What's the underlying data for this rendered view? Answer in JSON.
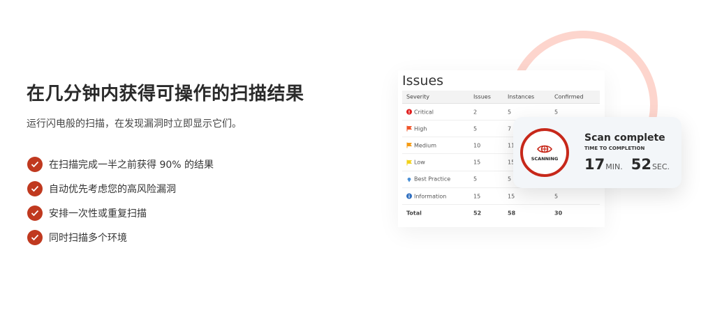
{
  "heading": "在几分钟内获得可操作的扫描结果",
  "subtitle": "运行闪电般的扫描，在发现漏洞时立即显示它们。",
  "features": [
    "在扫描完成一半之前获得 90% 的结果",
    "自动优先考虑您的高风险漏洞",
    "安排一次性或重复扫描",
    "同时扫描多个环境"
  ],
  "issues": {
    "title": "Issues",
    "headers": [
      "Severity",
      "Issues",
      "Instances",
      "Confirmed"
    ],
    "rows": [
      {
        "severity": "Critical",
        "icon": "exclamation-circle-icon",
        "color": "#e01e1e",
        "issues": "2",
        "instances": "5",
        "confirmed": "5"
      },
      {
        "severity": "High",
        "icon": "flag-icon",
        "color": "#f0562b",
        "issues": "5",
        "instances": "7",
        "confirmed": ""
      },
      {
        "severity": "Medium",
        "icon": "flag-icon",
        "color": "#f59b14",
        "issues": "10",
        "instances": "11",
        "confirmed": ""
      },
      {
        "severity": "Low",
        "icon": "flag-icon",
        "color": "#f2d21b",
        "issues": "15",
        "instances": "15",
        "confirmed": ""
      },
      {
        "severity": "Best Practice",
        "icon": "map-pin-icon",
        "color": "#4a8fd6",
        "issues": "5",
        "instances": "5",
        "confirmed": ""
      },
      {
        "severity": "Information",
        "icon": "info-circle-icon",
        "color": "#2f6fc0",
        "issues": "15",
        "instances": "15",
        "confirmed": "5"
      }
    ],
    "total": {
      "label": "Total",
      "issues": "52",
      "instances": "58",
      "confirmed": "30"
    }
  },
  "scan": {
    "badge": "SCANNING",
    "title": "Scan complete",
    "subtitle": "TIME TO COMPLETION",
    "minutes": "17",
    "min_unit": "MIN.",
    "seconds": "52",
    "sec_unit": "SEC."
  },
  "colors": {
    "accent": "#c0391f",
    "ring": "#fdd5cd"
  }
}
